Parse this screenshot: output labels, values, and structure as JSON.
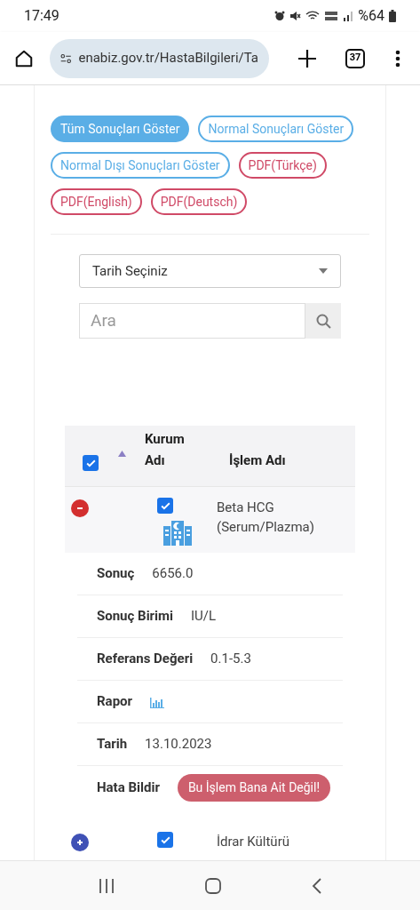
{
  "status_bar": {
    "time": "17:49",
    "battery": "%64"
  },
  "browser": {
    "url": "enabiz.gov.tr/HastaBilgileri/Ta",
    "tab_count": "37"
  },
  "filter_buttons": [
    {
      "label": "Tüm Sonuçları Göster",
      "selected": true,
      "color": "#5aaee6"
    },
    {
      "label": "Normal Sonuçları Göster",
      "selected": false,
      "color": "#5aaee6"
    },
    {
      "label": "Normal Dışı Sonuçları Göster",
      "selected": false,
      "color": "#5aaee6"
    },
    {
      "label": "PDF(Türkçe)",
      "selected": false,
      "color": "#d04a67"
    },
    {
      "label": "PDF(English)",
      "selected": false,
      "color": "#d04a67"
    },
    {
      "label": "PDF(Deutsch)",
      "selected": false,
      "color": "#d04a67"
    }
  ],
  "date_select": {
    "value": "Tarih Seçiniz"
  },
  "search": {
    "placeholder": "Ara"
  },
  "table": {
    "select_all_checked": true,
    "columns": [
      "Kurum Adı",
      "İşlem Adı"
    ],
    "rows": [
      {
        "expanded": true,
        "checked": true,
        "name": "Beta HCG (Serum/Plazma)",
        "details": [
          {
            "kind": "text",
            "label": "Sonuç",
            "value": "6656.0"
          },
          {
            "kind": "text",
            "label": "Sonuç Birimi",
            "value": "IU/L"
          },
          {
            "kind": "text",
            "label": "Referans Değeri",
            "value": "0.1-5.3"
          },
          {
            "kind": "chart",
            "label": "Rapor"
          },
          {
            "kind": "text",
            "label": "Tarih",
            "value": "13.10.2023"
          },
          {
            "kind": "button",
            "label": "Hata Bildir",
            "value": "Bu İşlem Bana Ait Değil!"
          }
        ]
      },
      {
        "expanded": false,
        "checked": true,
        "name": "İdrar Kültürü"
      }
    ]
  }
}
